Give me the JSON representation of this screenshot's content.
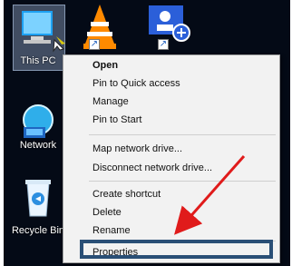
{
  "desktop": {
    "icons": [
      {
        "label": "This PC",
        "name": "this-pc-icon"
      },
      {
        "label": "",
        "name": "vlc-icon"
      },
      {
        "label": "",
        "name": "user-add-shortcut-icon"
      },
      {
        "label": "Network",
        "name": "network-icon"
      },
      {
        "label": "Recycle Bin",
        "name": "recycle-bin-icon"
      }
    ]
  },
  "context_menu": {
    "items": [
      "Open",
      "Pin to Quick access",
      "Manage",
      "Pin to Start",
      "Map network drive...",
      "Disconnect network drive...",
      "Create shortcut",
      "Delete",
      "Rename",
      "Properties"
    ]
  },
  "colors": {
    "desktop": "#040a16",
    "menu": "#f2f2f2",
    "highlight": "#2a4f76",
    "arrow": "#e01b1b"
  }
}
